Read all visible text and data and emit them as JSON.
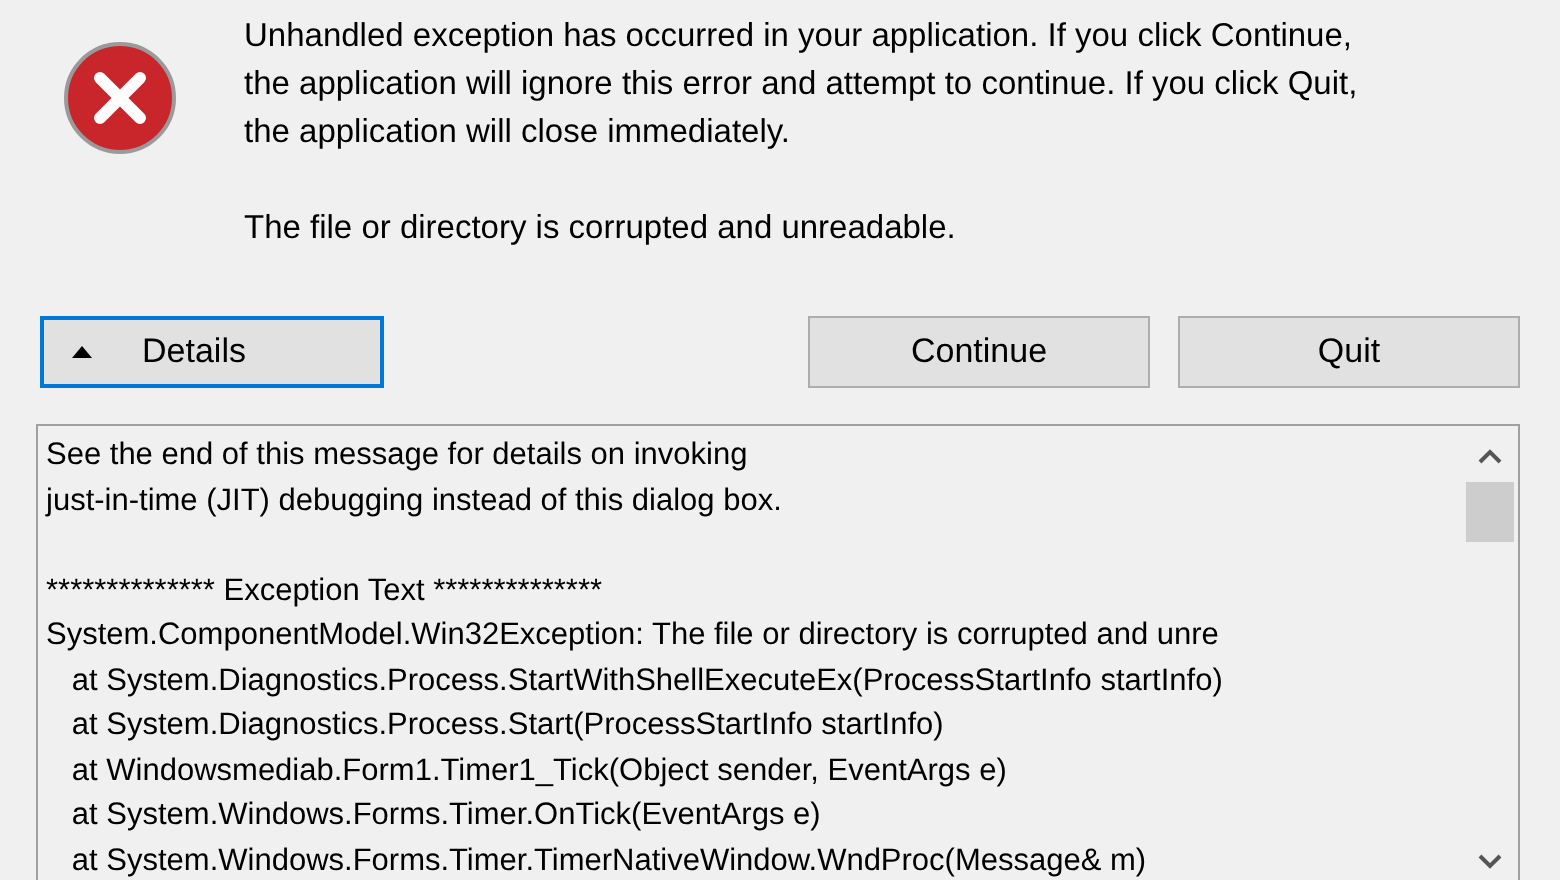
{
  "message": {
    "paragraphs": [
      "Unhandled exception has occurred in your application. If you click Continue, the application will ignore this error and attempt to continue. If you click Quit, the application will close immediately.",
      "The file or directory is corrupted and unreadable."
    ]
  },
  "buttons": [
    {
      "kind": "toggle",
      "label": "Details",
      "expanded": true,
      "focused": true
    },
    {
      "kind": "push",
      "label": "Continue",
      "focused": false
    },
    {
      "kind": "push",
      "label": "Quit",
      "focused": false
    }
  ],
  "details": {
    "blocks": [
      [
        "See the end of this message for details on invoking",
        "just-in-time (JIT) debugging instead of this dialog box."
      ],
      [
        "************** Exception Text **************",
        "System.ComponentModel.Win32Exception: The file or directory is corrupted and unre",
        "   at System.Diagnostics.Process.StartWithShellExecuteEx(ProcessStartInfo startInfo)",
        "   at System.Diagnostics.Process.Start(ProcessStartInfo startInfo)",
        "   at Windowsmediab.Form1.Timer1_Tick(Object sender, EventArgs e)",
        "   at System.Windows.Forms.Timer.OnTick(EventArgs e)",
        "   at System.Windows.Forms.Timer.TimerNativeWindow.WndProc(Message& m)"
      ]
    ]
  }
}
